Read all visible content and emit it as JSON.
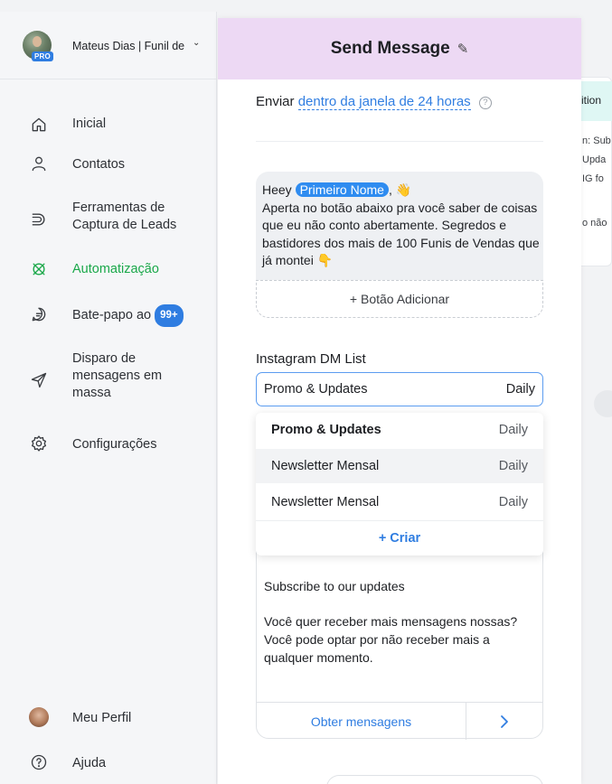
{
  "sidebar": {
    "account": {
      "name": "Mateus Dias | Funil de",
      "badge": "PRO"
    },
    "items": [
      {
        "label": "Inicial",
        "icon": "home-icon"
      },
      {
        "label": "Contatos",
        "icon": "user-icon"
      },
      {
        "label": "Ferramentas de Captura de Leads",
        "icon": "magnet-icon"
      },
      {
        "label": "Automatização",
        "icon": "automation-icon",
        "active": true
      },
      {
        "label": "Bate-papo ao",
        "icon": "chat-icon",
        "badge": "99+"
      },
      {
        "label": "Disparo de mensagens em massa",
        "icon": "send-icon"
      },
      {
        "label": "Configurações",
        "icon": "gear-icon"
      }
    ],
    "bottom": [
      {
        "label": "Meu Perfil",
        "icon": "profile-avatar"
      },
      {
        "label": "Ajuda",
        "icon": "help-icon"
      }
    ],
    "active_color": "#1aa84a"
  },
  "editor": {
    "title": "Send Message",
    "send_prefix": "Enviar",
    "send_window": "dentro da janela de 24 horas",
    "message": {
      "greeting": "Heey",
      "variable": "Primeiro Nome",
      "greeting_end": ", 👋",
      "body": "Aperta no botão abaixo pra você saber de coisas que eu não conto abertamente. Segredos e bastidores dos mais de 100 Funis de Vendas que já montei 👇"
    },
    "add_button": "+ Botão Adicionar",
    "list_label": "Instagram DM List",
    "selected": {
      "name": "Promo & Updates",
      "frequency": "Daily"
    },
    "dropdown": [
      {
        "name": "Promo & Updates",
        "frequency": "Daily"
      },
      {
        "name": "Newsletter Mensal",
        "frequency": "Daily"
      },
      {
        "name": "Newsletter Mensal",
        "frequency": "Daily"
      }
    ],
    "create_label": "+ Criar",
    "subscribe": {
      "title": "Subscribe to our updates",
      "description": "Você quer receber mais mensagens nossas? Você pode optar por não receber mais a qualquer momento.",
      "button": "Obter mensagens"
    },
    "header_color": "#edd9f4",
    "accent_color": "#2f7de1"
  },
  "background": {
    "tag": "ition",
    "lines": [
      "n: Sub",
      "Upda",
      "IG fo",
      "o não"
    ]
  }
}
